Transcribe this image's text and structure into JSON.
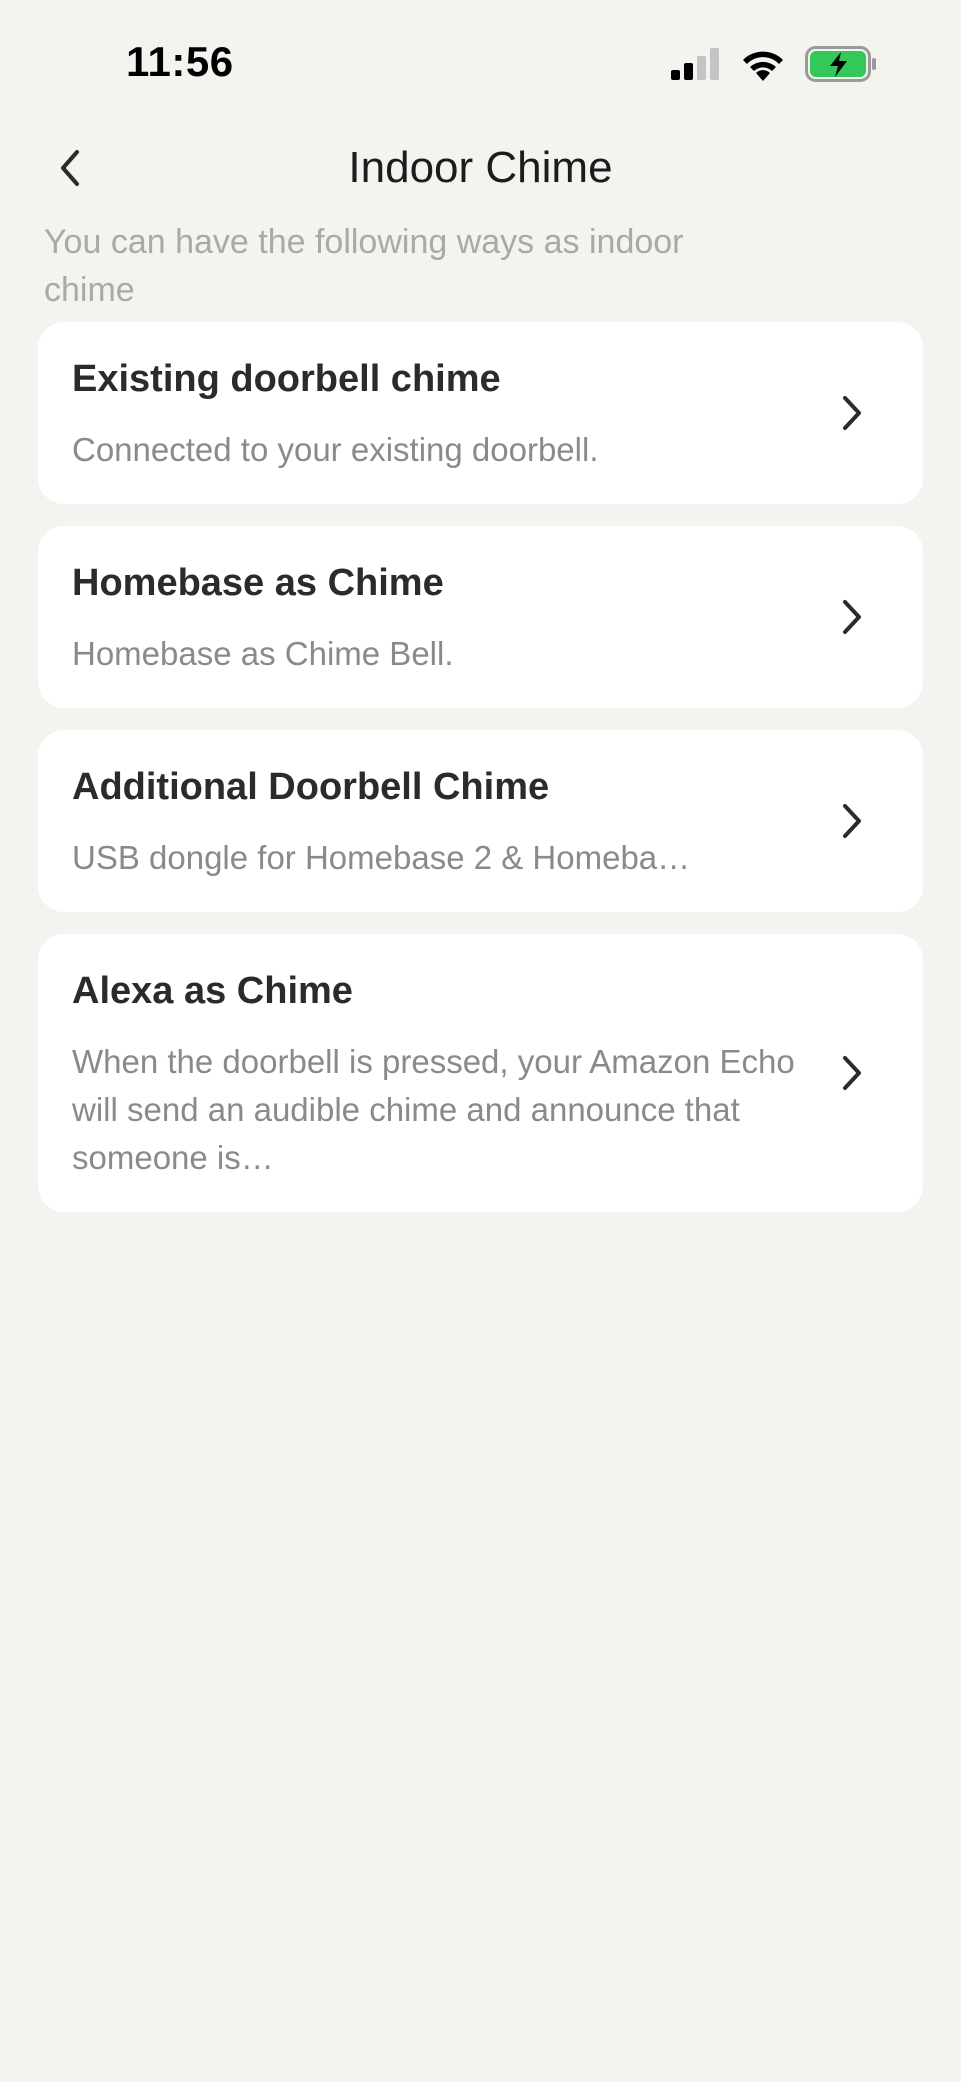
{
  "status_bar": {
    "time": "11:56"
  },
  "header": {
    "title": "Indoor Chime",
    "back_icon": "chevron-left-icon"
  },
  "subtitle": "You can have the following ways as indoor chime",
  "options": [
    {
      "title": "Existing doorbell chime",
      "description": "Connected to your existing doorbell."
    },
    {
      "title": "Homebase as Chime",
      "description": "Homebase as Chime Bell."
    },
    {
      "title": "Additional Doorbell Chime",
      "description": "USB dongle for Homebase 2 & Homeba…"
    },
    {
      "title": "Alexa as Chime",
      "description": "When the doorbell is pressed, your Amazon Echo will send an audible chime and announce that someone is…"
    }
  ],
  "colors": {
    "background": "#f3f3ef",
    "card": "#ffffff",
    "battery_fill": "#34c759"
  }
}
